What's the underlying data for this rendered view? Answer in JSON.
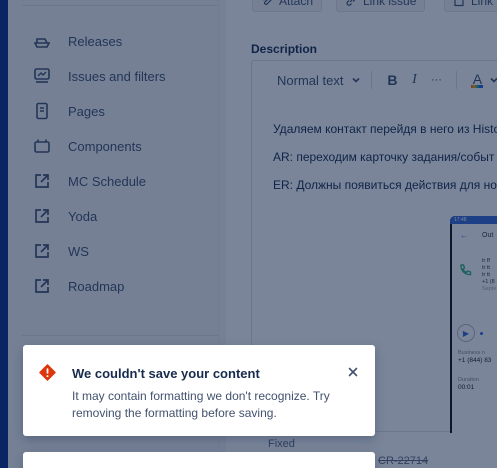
{
  "sidebar": {
    "items": [
      {
        "label": "Releases",
        "icon": "ship-icon"
      },
      {
        "label": "Issues and filters",
        "icon": "issues-icon"
      },
      {
        "label": "Pages",
        "icon": "page-icon"
      },
      {
        "label": "Components",
        "icon": "components-icon"
      },
      {
        "label": "MC Schedule",
        "icon": "external-link-icon"
      },
      {
        "label": "Yoda",
        "icon": "external-link-icon"
      },
      {
        "label": "WS",
        "icon": "external-link-icon"
      },
      {
        "label": "Roadmap",
        "icon": "external-link-icon"
      }
    ]
  },
  "issue": {
    "actions": {
      "attach": "Attach",
      "link_issue": "Link issue",
      "link": "Link"
    },
    "description_label": "Description",
    "toolbar": {
      "text_style": "Normal text",
      "bold": "B",
      "italic": "I",
      "more": "···",
      "text_color": "A"
    },
    "description_lines": [
      "Удаляем контакт перейдя в него из Histo",
      "AR: переходим карточку задания/событ",
      "ER: Должны появиться действия для ном"
    ],
    "phone": {
      "status_time": "17:48",
      "title": "Out",
      "caller_lines": [
        "tr ff",
        "tr tt",
        "tr tt",
        "+1 (8",
        "Septe"
      ],
      "business_label": "Business n",
      "business_value": "+1 (844) 83",
      "duration_label": "Duration",
      "duration_value": "00:01"
    },
    "status": "Fixed",
    "issue_key": "CR-22714"
  },
  "toast": {
    "title": "We couldn't save your content",
    "body": "It may contain formatting we don't recognize. Try removing the formatting before saving."
  },
  "colors": {
    "overlay": "#091e42",
    "error_icon": "#de350b",
    "sidebar_bg": "#f4f5f7",
    "text_color_accent": "#ff5630"
  }
}
